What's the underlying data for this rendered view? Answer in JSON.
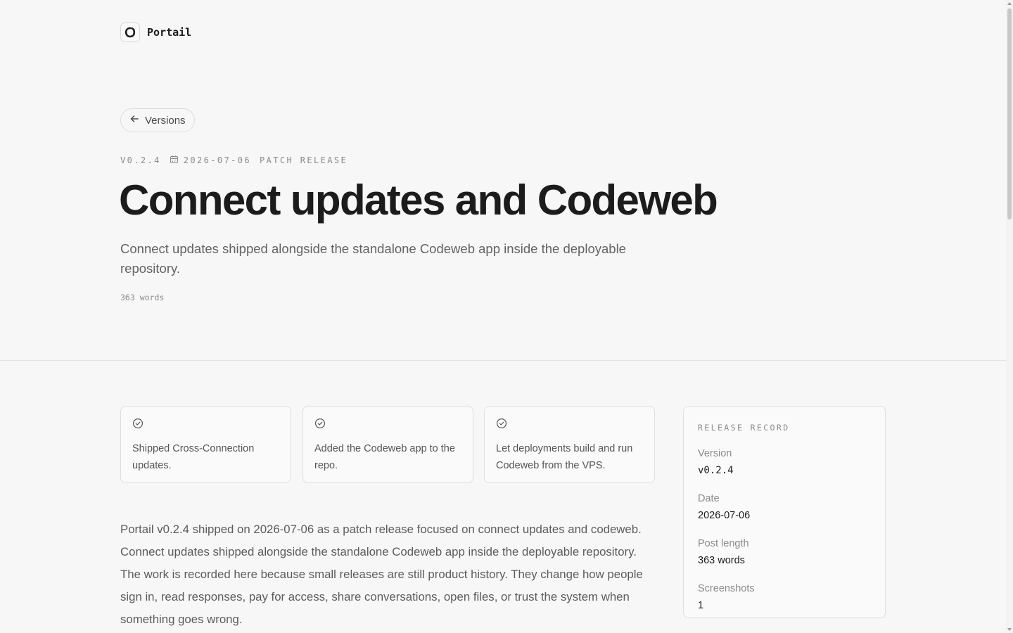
{
  "brand": {
    "name": "Portail",
    "logo_icon": "portail-logo-icon"
  },
  "back": {
    "label": "Versions",
    "icon": "arrow-left-icon"
  },
  "meta": {
    "version": "V0.2.4",
    "date": "2026-07-06",
    "date_icon": "calendar-icon",
    "type": "PATCH RELEASE"
  },
  "title": "Connect updates and Codeweb",
  "subtitle": "Connect updates shipped alongside the standalone Codeweb app inside the deployable repository.",
  "word_count": "363 words",
  "highlights": [
    {
      "icon": "check-circle-icon",
      "text": "Shipped Cross-Connection updates."
    },
    {
      "icon": "check-circle-icon",
      "text": "Added the Codeweb app to the repo."
    },
    {
      "icon": "check-circle-icon",
      "text": "Let deployments build and run Codeweb from the VPS."
    }
  ],
  "body": "Portail v0.2.4 shipped on 2026-07-06 as a patch release focused on connect updates and codeweb. Connect updates shipped alongside the standalone Codeweb app inside the deployable repository. The work is recorded here because small releases are still product history. They change how people sign in, read responses, pay for access, share conversations, open files, or trust the system when something goes wrong.",
  "record": {
    "heading": "RELEASE RECORD",
    "rows": [
      {
        "label": "Version",
        "value": "v0.2.4"
      },
      {
        "label": "Date",
        "value": "2026-07-06"
      },
      {
        "label": "Post length",
        "value": "363 words"
      },
      {
        "label": "Screenshots",
        "value": "1"
      }
    ]
  }
}
